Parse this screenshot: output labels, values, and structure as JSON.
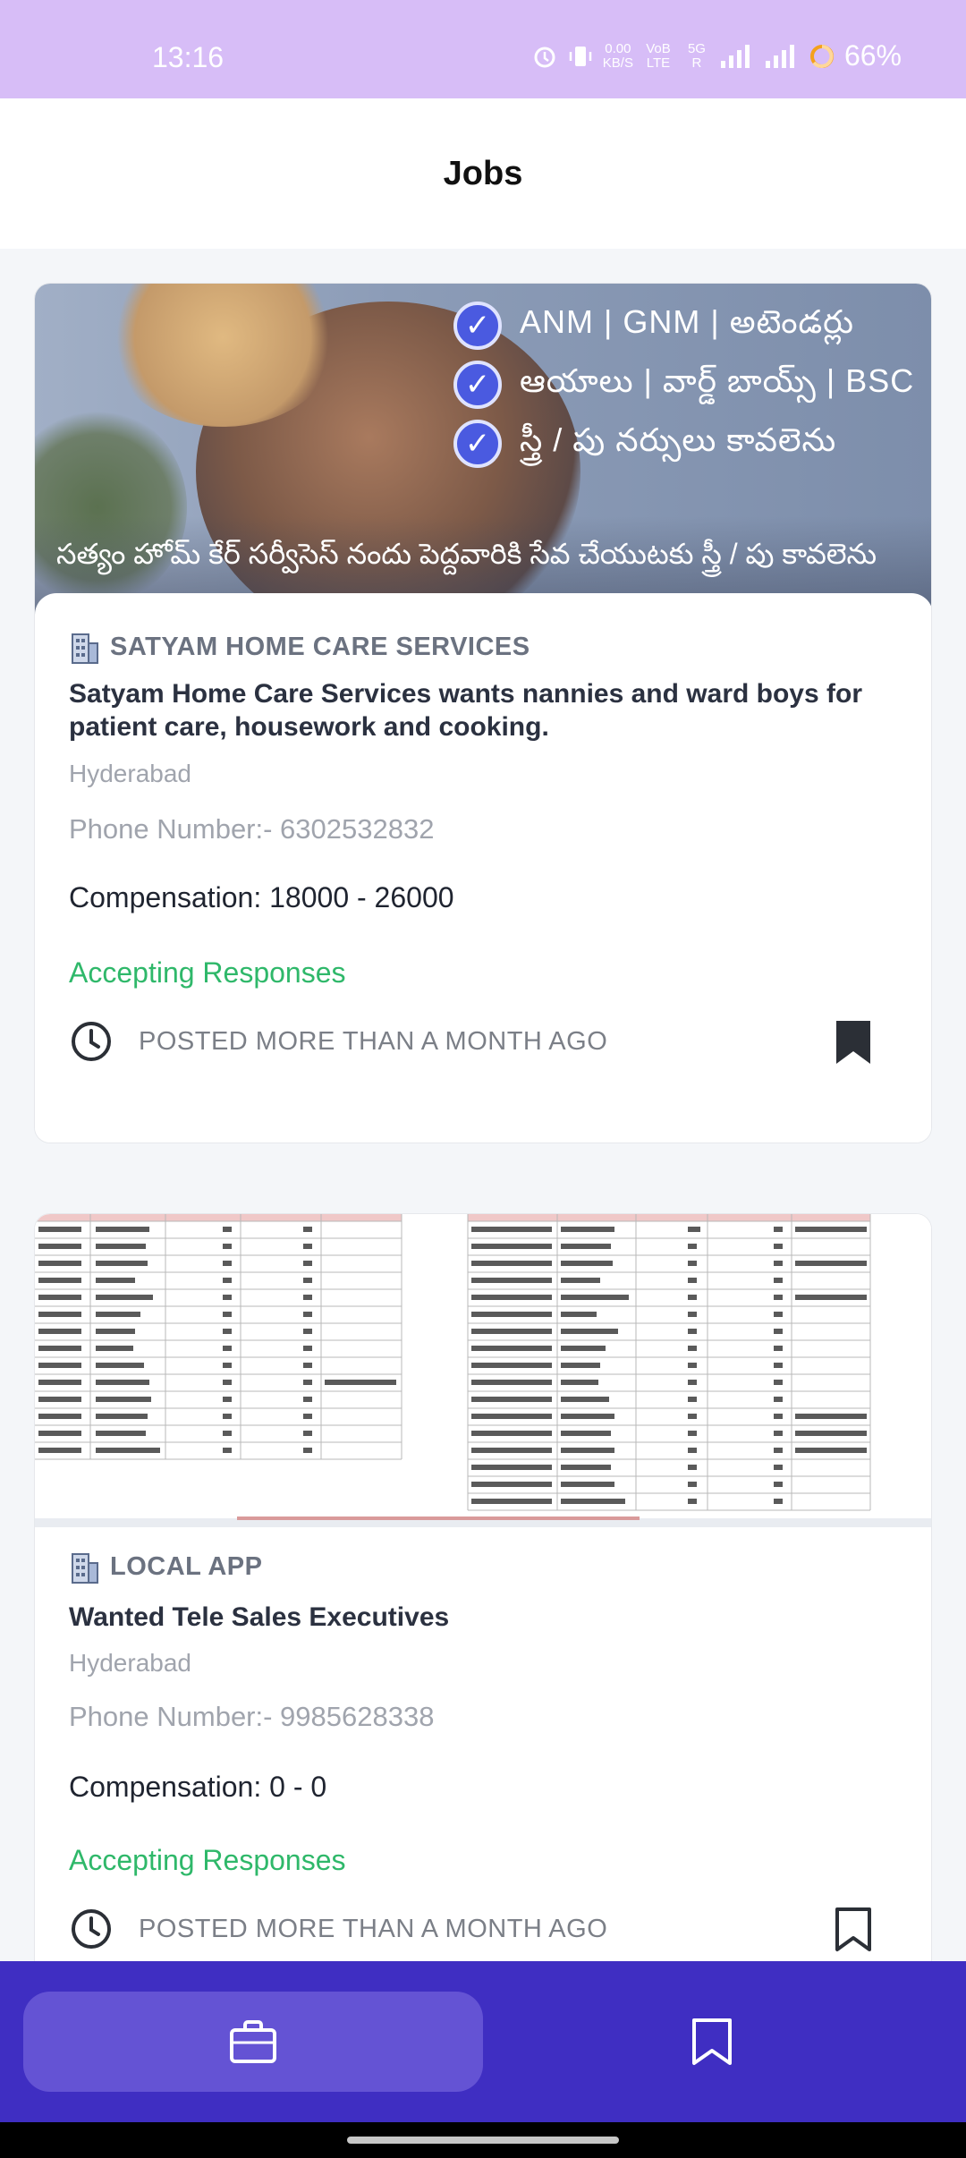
{
  "status_bar": {
    "time": "13:16",
    "net_speed_value": "0.00",
    "net_speed_unit": "KB/S",
    "volte_label": "VoB LTE",
    "network_label": "5G R",
    "battery": "66%",
    "icons": [
      "alarm-icon",
      "vibrate-icon",
      "signal-icon",
      "battery-icon"
    ]
  },
  "header": {
    "title": "Jobs"
  },
  "jobs": [
    {
      "banner": {
        "checks": [
          "ANM | GNM | అటెండర్లు",
          "ఆయాలు | వార్డ్ బాయ్స్ | BSC",
          "స్త్రీ / పు నర్సులు కావలెను"
        ],
        "caption": "సత్యం హోమ్ కేర్ సర్వీసెస్ నందు పెద్దవారికి సేవ చేయుటకు స్త్రీ / పు కావలెను"
      },
      "company": "SATYAM HOME CARE SERVICES",
      "title": "Satyam Home Care Services wants nannies and ward boys for patient care, housework and cooking.",
      "location": "Hyderabad",
      "phone": "Phone Number:- 6302532832",
      "compensation": "Compensation: 18000 - 26000",
      "status": "Accepting Responses",
      "posted": "POSTED MORE THAN A MONTH AGO",
      "saved": true
    },
    {
      "company": "LOCAL APP",
      "title": "Wanted Tele Sales Executives",
      "location": "Hyderabad",
      "phone": "Phone Number:- 9985628338",
      "compensation": "Compensation: 0 - 0",
      "status": "Accepting Responses",
      "posted": "POSTED MORE THAN A MONTH AGO",
      "saved": false
    }
  ],
  "bottom_nav": {
    "items": [
      {
        "name": "jobs",
        "icon": "briefcase-icon",
        "active": true
      },
      {
        "name": "saved",
        "icon": "bookmark-icon",
        "active": false
      }
    ]
  },
  "colors": {
    "status_bar": "#d7bdf7",
    "accent": "#3f2ec2",
    "active_nav": "#6453d4",
    "accepting": "#2fb86a"
  }
}
